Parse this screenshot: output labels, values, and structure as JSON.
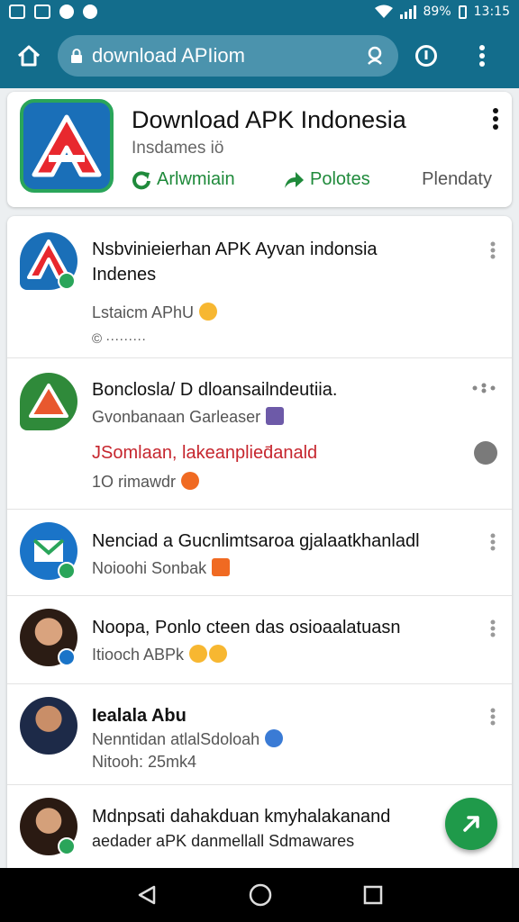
{
  "status_bar": {
    "battery": "89%",
    "time": "13:15"
  },
  "browser": {
    "url": "download APIiom"
  },
  "app_header": {
    "title": "Download APK Indonesia",
    "subtitle": "Insdames iö",
    "actions": [
      {
        "label": "Arlwmiain",
        "icon": "refresh-icon"
      },
      {
        "label": "Polotes",
        "icon": "share-icon"
      },
      {
        "label": "Plendaty"
      }
    ]
  },
  "feed": [
    {
      "title": "Nsbvinieierhan APK Ayvan indonsia",
      "title2": "Indenes",
      "line1": "Lstaicm APhU",
      "line2": "©  ·········",
      "avatar": "apk-logo"
    },
    {
      "title": "Bonclosla/ D dloansailndeutiia.",
      "line1": "Gvonbanaan Garleaser",
      "red": "JSomlaan, lakeanplied̄anald",
      "line2": "1O rimawdr"
    },
    {
      "title": "Nenciad a Gucnlimtsaroa gjalaatkhanladl",
      "line1": "Noioohi Sonbak"
    },
    {
      "title": "Noopa, Ponlo cteen das osioaalatuasn",
      "line1": "Itiooch ABPk"
    },
    {
      "title": "Iealala Abu",
      "line1": "Nenntidan atlalSdoloah",
      "line2": "Nitooh: 25mk4"
    },
    {
      "title": "Mdnpsati dahakduan kmyhalakanand",
      "line1": "aedader aPK danmellall Sdmawares"
    }
  ],
  "colors": {
    "primary": "#136d8c",
    "accent": "#1f9a4a",
    "red": "#c6262e"
  }
}
